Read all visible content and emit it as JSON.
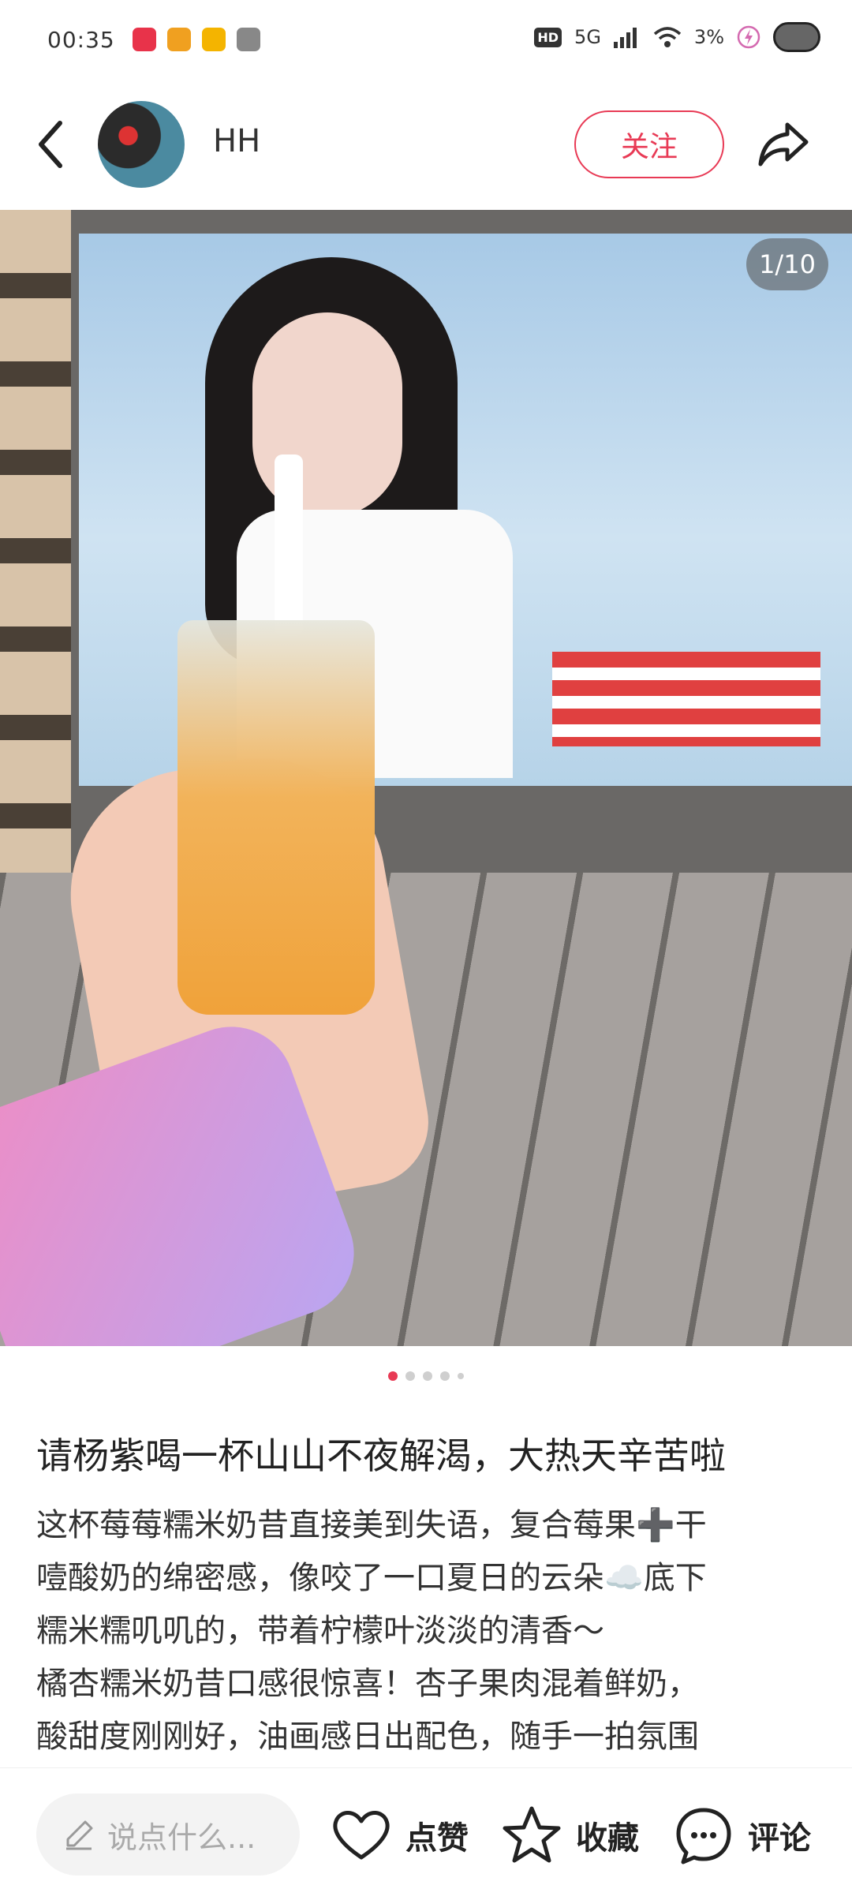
{
  "status_bar": {
    "time": "00:35",
    "notifications": [
      "app-icon",
      "app-icon",
      "weibo-icon",
      "wechat-icon"
    ],
    "hd": "HD",
    "network": "5G",
    "battery": "3%"
  },
  "header": {
    "author": "HH",
    "follow_label": "关注"
  },
  "photo": {
    "page_counter": "1/10",
    "total_dots": 5,
    "active_dot": 0
  },
  "post": {
    "title": "请杨紫喝一杯山山不夜解渴，大热天辛苦啦",
    "lines": [
      "这杯莓莓糯米奶昔直接美到失语，复合莓果➕干",
      "噎酸奶的绵密感，像咬了一口夏日的云朵☁️底下",
      "糯米糯叽叽的，带着柠檬叶淡淡的清香～",
      "橘杏糯米奶昔口感很惊喜！杏子果肉混着鲜奶，",
      "酸甜度刚刚好，油画感日出配色，随手一拍氛围"
    ]
  },
  "bottom_bar": {
    "comment_placeholder": "说点什么...",
    "like_label": "点赞",
    "collect_label": "收藏",
    "comment_label": "评论"
  },
  "colors": {
    "accent": "#e83a55",
    "text": "#222222"
  }
}
